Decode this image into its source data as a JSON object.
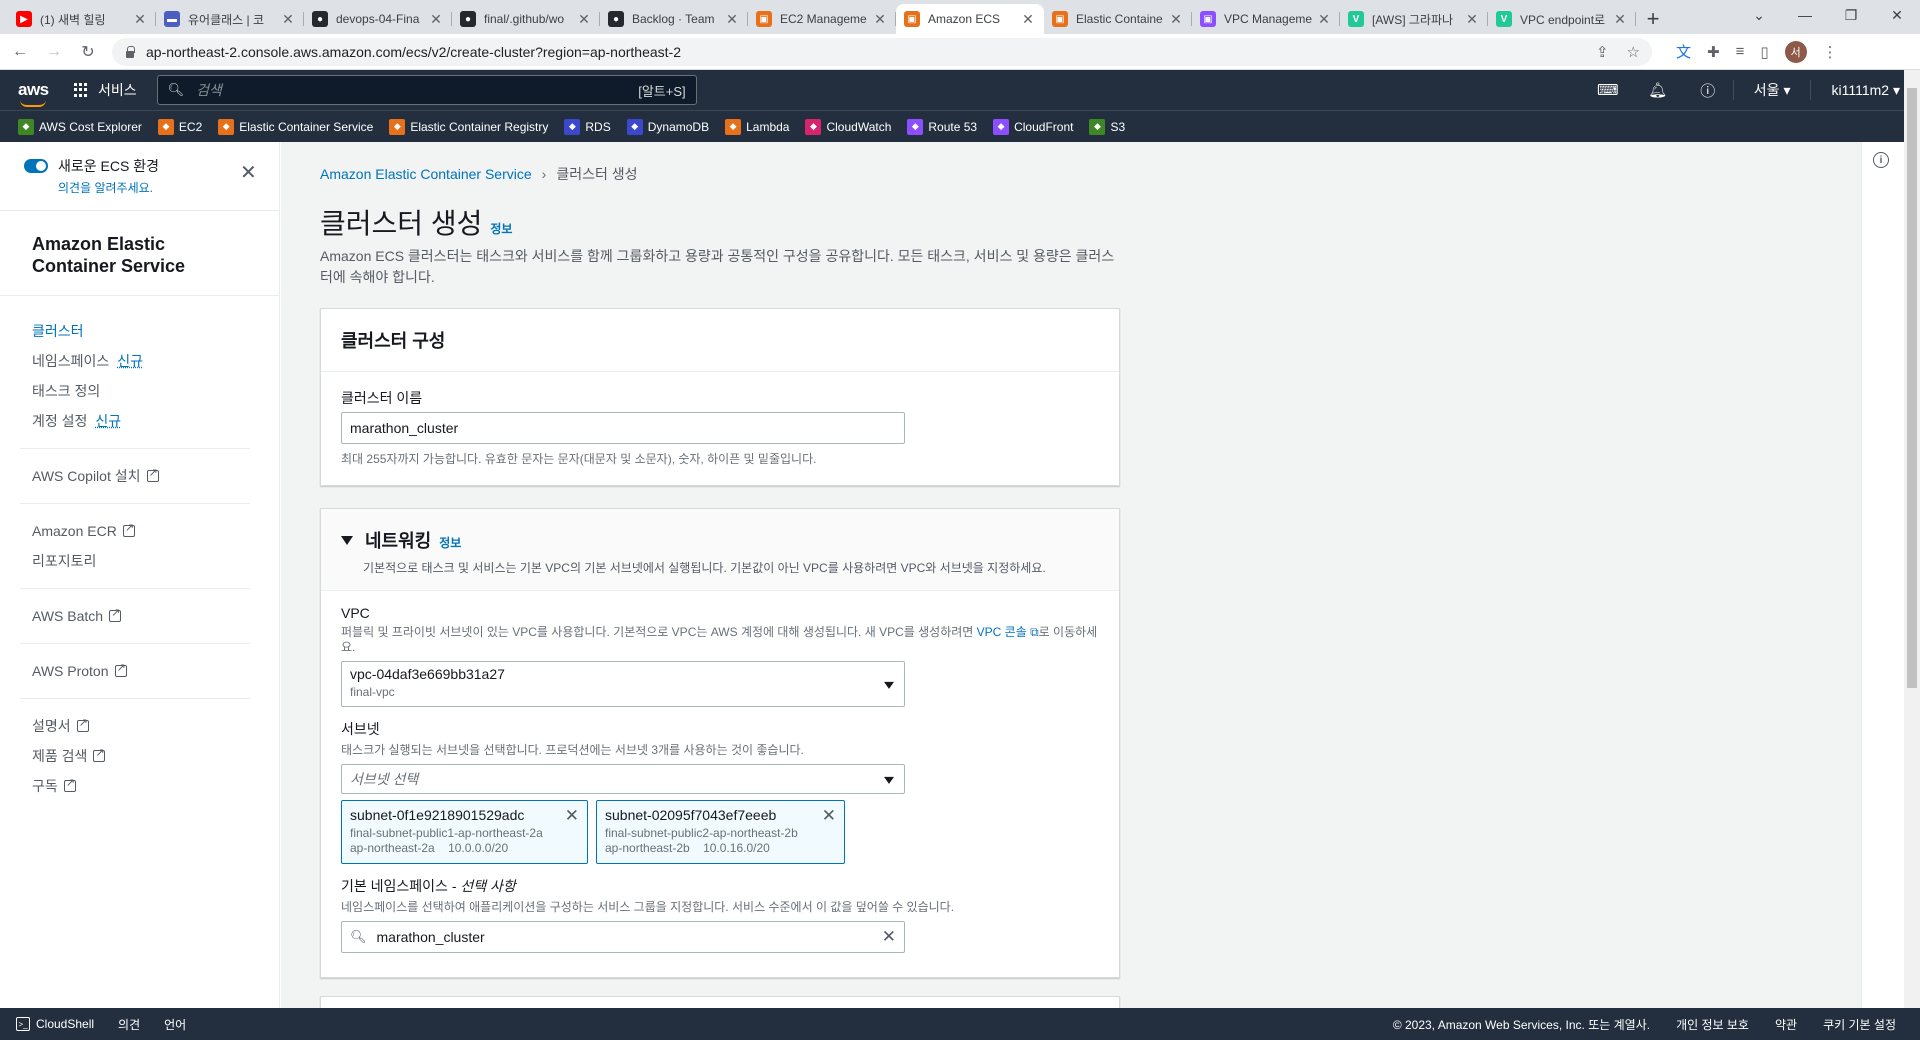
{
  "browser": {
    "tabs": [
      {
        "title": "(1) 새벽 힐링",
        "color": "#ff0000",
        "glyph": "▶"
      },
      {
        "title": "유어클래스 | 코",
        "color": "#4a5fc1",
        "glyph": "▬"
      },
      {
        "title": "devops-04-Fina",
        "color": "#24292f",
        "glyph": "●"
      },
      {
        "title": "final/.github/wo",
        "color": "#24292f",
        "glyph": "●"
      },
      {
        "title": "Backlog · Team",
        "color": "#24292f",
        "glyph": "●"
      },
      {
        "title": "EC2 Manageme",
        "color": "#e7711b",
        "glyph": "▣"
      },
      {
        "title": "Amazon ECS",
        "color": "#e7711b",
        "glyph": "▣"
      },
      {
        "title": "Elastic Containe",
        "color": "#e7711b",
        "glyph": "▣"
      },
      {
        "title": "VPC Manageme",
        "color": "#8c4fff",
        "glyph": "▣"
      },
      {
        "title": "[AWS] 그라파나",
        "color": "#20c997",
        "glyph": "V"
      },
      {
        "title": "VPC endpoint로",
        "color": "#20c997",
        "glyph": "V"
      }
    ],
    "url": "ap-northeast-2.console.aws.amazon.com/ecs/v2/create-cluster?region=ap-northeast-2",
    "avatar_letter": "서"
  },
  "aws_nav": {
    "services_label": "서비스",
    "search_placeholder": "검색",
    "search_shortcut": "[알트+S]",
    "region": "서울 ▾",
    "account": "ki1111m2 ▾"
  },
  "favorites": [
    {
      "label": "AWS Cost Explorer",
      "color": "#3f8624"
    },
    {
      "label": "EC2",
      "color": "#e7711b"
    },
    {
      "label": "Elastic Container Service",
      "color": "#e7711b"
    },
    {
      "label": "Elastic Container Registry",
      "color": "#e7711b"
    },
    {
      "label": "RDS",
      "color": "#3b48cc"
    },
    {
      "label": "DynamoDB",
      "color": "#3b48cc"
    },
    {
      "label": "Lambda",
      "color": "#e7711b"
    },
    {
      "label": "CloudWatch",
      "color": "#d6246e"
    },
    {
      "label": "Route 53",
      "color": "#8c4fff"
    },
    {
      "label": "CloudFront",
      "color": "#8c4fff"
    },
    {
      "label": "S3",
      "color": "#3f8624"
    }
  ],
  "sidenav": {
    "toggle_label": "새로운 ECS 환경",
    "feedback_link": "의견을 알려주세요.",
    "title": "Amazon Elastic Container Service",
    "new_badge": "신규",
    "items": [
      {
        "label": "클러스터"
      },
      {
        "label": "네임스페이스"
      },
      {
        "label": "태스크 정의"
      },
      {
        "label": "계정 설정"
      },
      {
        "label": "AWS Copilot 설치"
      },
      {
        "label": "Amazon ECR"
      },
      {
        "label": "리포지토리"
      },
      {
        "label": "AWS Batch"
      },
      {
        "label": "AWS Proton"
      },
      {
        "label": "설명서"
      },
      {
        "label": "제품 검색"
      },
      {
        "label": "구독"
      }
    ]
  },
  "main": {
    "breadcrumb": {
      "root": "Amazon Elastic Container Service",
      "current": "클러스터 생성"
    },
    "title": "클러스터 생성",
    "info_link": "정보",
    "description": "Amazon ECS 클러스터는 태스크와 서비스를 함께 그룹화하고 용량과 공통적인 구성을 공유합니다. 모든 태스크, 서비스 및 용량은 클러스터에 속해야 합니다.",
    "cluster_config": {
      "heading": "클러스터 구성",
      "name_label": "클러스터 이름",
      "name_value": "marathon_cluster",
      "name_hint": "최대 255자까지 가능합니다. 유효한 문자는 문자(대문자 및 소문자), 숫자, 하이픈 및 밑줄입니다."
    },
    "networking": {
      "heading": "네트워킹",
      "description": "기본적으로 태스크 및 서비스는 기본 VPC의 기본 서브넷에서 실행됩니다. 기본값이 아닌 VPC를 사용하려면 VPC와 서브넷을 지정하세요.",
      "vpc_label": "VPC",
      "vpc_desc_before": "퍼블릭 및 프라이빗 서브넷이 있는 VPC를 사용합니다. 기본적으로 VPC는 AWS 계정에 대해 생성됩니다. 새 VPC를 생성하려면",
      "vpc_console_link": "VPC 콘솔",
      "vpc_desc_after": "로 이동하세요.",
      "vpc_value": "vpc-04daf3e669bb31a27",
      "vpc_name": "final-vpc",
      "subnet_label": "서브넷",
      "subnet_desc": "태스크가 실행되는 서브넷을 선택합니다. 프로덕션에는 서브넷 3개를 사용하는 것이 좋습니다.",
      "subnet_placeholder": "서브넷 선택",
      "subnets": [
        {
          "id": "subnet-0f1e9218901529adc",
          "name": "final-subnet-public1-ap-northeast-2a",
          "az": "ap-northeast-2a",
          "cidr": "10.0.0.0/20"
        },
        {
          "id": "subnet-02095f7043ef7eeeb",
          "name": "final-subnet-public2-ap-northeast-2b",
          "az": "ap-northeast-2b",
          "cidr": "10.0.16.0/20"
        }
      ],
      "namespace_label": "기본 네임스페이스 - ",
      "namespace_optional": "선택 사항",
      "namespace_desc": "네임스페이스를 선택하여 애플리케이션을 구성하는 서비스 그룹을 지정합니다. 서비스 수준에서 이 값을 덮어쓸 수 있습니다.",
      "namespace_value": "marathon_cluster"
    }
  },
  "footer": {
    "cloudshell": "CloudShell",
    "feedback": "의견",
    "language": "언어",
    "copyright": "© 2023, Amazon Web Services, Inc. 또는 계열사.",
    "privacy": "개인 정보 보호",
    "terms": "약관",
    "cookies": "쿠키 기본 설정"
  }
}
